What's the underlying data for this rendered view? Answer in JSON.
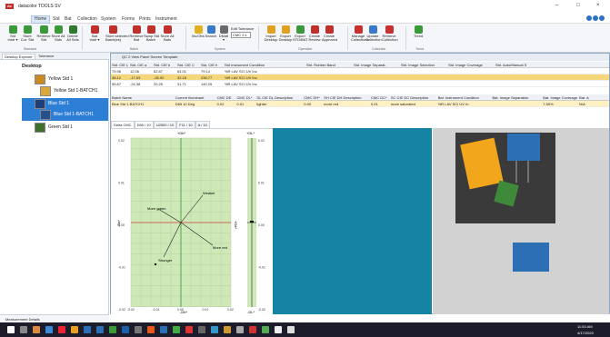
{
  "app": {
    "title": "datacolor TOOLS SV",
    "logo_text": "dc"
  },
  "window_controls": {
    "minimize": "–",
    "maximize": "□",
    "close": "×"
  },
  "menu": [
    "Home",
    "Std",
    "Bat",
    "Collection",
    "System",
    "Forms",
    "Prints",
    "Instrument"
  ],
  "ribbon": {
    "buttons": [
      {
        "label": "Std\nInstr ▾",
        "color": "#3a9a3a"
      },
      {
        "label": "Store\nCur. Std",
        "color": "#3a9a3a"
      },
      {
        "label": "Retrieve\nStd",
        "color": "#3a9a3a"
      },
      {
        "label": "Store All\nStds",
        "color": "#3a9a3a"
      },
      {
        "label": "Delete\nAll Stds",
        "color": "#2d7a2d"
      },
      {
        "label": "Bat\nInstr ▾",
        "color": "#c0302a"
      },
      {
        "label": "Store selected\nBatch(es)",
        "color": "#c0302a"
      },
      {
        "label": "Retrieve\nBat",
        "color": "#c0302a"
      },
      {
        "label": "Swap Std\nBatch",
        "color": "#c0302a"
      },
      {
        "label": "Store All\nBats",
        "color": "#c0302a"
      },
      {
        "label": "Illu/Obs",
        "color": "#e0b020"
      },
      {
        "label": "Search",
        "color": "#3a78c8"
      },
      {
        "label": "DMatl\n▾",
        "color": "#6a6a6a"
      },
      {
        "label": "Import\nDesktop",
        "color": "#e0a020"
      },
      {
        "label": "Export\nDesktop",
        "color": "#e0a020"
      },
      {
        "label": "Export\nSTD/BAT",
        "color": "#3a9a3a"
      },
      {
        "label": "Create\nReview",
        "color": "#c0302a"
      },
      {
        "label": "Create\nApproved",
        "color": "#c0302a"
      },
      {
        "label": "Manage\nCollections",
        "color": "#c83030"
      },
      {
        "label": "Update\nCollection",
        "color": "#3a78c8"
      },
      {
        "label": "Retrieve\nCollection",
        "color": "#c83030"
      },
      {
        "label": "Trend",
        "color": "#3a9a3a"
      }
    ],
    "edit_tolerance": "Edit Tolerance",
    "tolerance_value": "CMC 2:1",
    "groups": [
      "Standard",
      "Batch",
      "System",
      "Operation",
      "Collection",
      "Trend"
    ]
  },
  "left_tabs": [
    "Desktop Explorer",
    "Tolerance"
  ],
  "tree": {
    "root": "Desktop",
    "items": [
      {
        "label": "Yellow Std 1",
        "color": "#c98a20"
      },
      {
        "label": "Yellow Std 1-BATCH1",
        "color": "#d9a838"
      },
      {
        "label": "Blue Std 1",
        "color": "#1f3f7a"
      },
      {
        "label": "Blue Std 1-BATCH1",
        "color": "#24508f"
      },
      {
        "label": "Green Std 1",
        "color": "#3f6f2a"
      }
    ]
  },
  "measurement_details": "Measurement Details",
  "qc_title": "QC 2 View Panel Screen Template",
  "upper_grid": {
    "headers": [
      "Std. CIE L",
      "Std. CIE a",
      "Std. CIE b",
      "Std. CIE C",
      "Std. CIE h",
      "Std Instrument Condition",
      "Std. Rubber Band",
      "Std. Image Separat.",
      "Std. Image Selection",
      "Std. Image Coverage",
      "Std. Auto/Manual S"
    ],
    "rows": [
      [
        "79.96",
        "12.06",
        "62.87",
        "64.01",
        "79.14",
        "%R LAV SCI UV Inc",
        "",
        "",
        "",
        "",
        ""
      ],
      [
        "48.12",
        "-17.63",
        "-26.92",
        "32.18",
        "236.77",
        "%R LAV SCI UV Inc",
        "",
        "",
        "",
        "",
        ""
      ],
      [
        "55.87",
        "-24.38",
        "20.26",
        "31.71",
        "140.25",
        "%R LAV SCI UV Inc",
        "",
        "",
        "",
        "",
        ""
      ]
    ]
  },
  "lower_grid": {
    "headers": [
      "Batch Name",
      "Current Illuminant",
      "CMC DE",
      "CMC DL*",
      "SL CIE DL Description",
      "CMC DH*",
      "SH CIE DH Description",
      "CMC DC*",
      "SC CIE DC Description",
      "Bat. Instrument Condition",
      "Bat. Image Separation",
      "Bat. Image Coverage",
      "Bat. A"
    ],
    "rows": [
      [
        "Blue Std 1-BATCH1",
        "D65 10 Deg",
        "0.02",
        "0.01",
        "lighter",
        "0.00",
        "more red",
        "0.01",
        "more saturated",
        "%R LAV SCI UV In",
        "",
        "7.55%",
        "N/A",
        "Auto"
      ]
    ]
  },
  "view_tabs": [
    "Delta CMC",
    "D65 / 10",
    "U2500 / 10",
    "F11 / 10",
    "A / 10"
  ],
  "plot": {
    "top_label": "+Db*",
    "bottom_label": "-Db*",
    "left_label": "-Da*",
    "right_label": "+Da*",
    "directions": {
      "weaker": "Weaker",
      "more_green": "More green",
      "more_red": "More red",
      "stronger": "Stronger"
    },
    "x_ticks": [
      "-0.02",
      "-0.01",
      "0.00",
      "0.01",
      "0.02"
    ],
    "y_ticks": [
      "0.02",
      "0.01",
      "0.00",
      "-0.01",
      "-0.02"
    ],
    "dl_top": "+DL*",
    "dl_bottom": "-DL*",
    "dl_ticks": [
      "0.02",
      "0.01",
      "0.00",
      "-0.01",
      "-0.02"
    ]
  },
  "taskbar": {
    "time": "11:53 AM",
    "date": "4/17/2020"
  }
}
